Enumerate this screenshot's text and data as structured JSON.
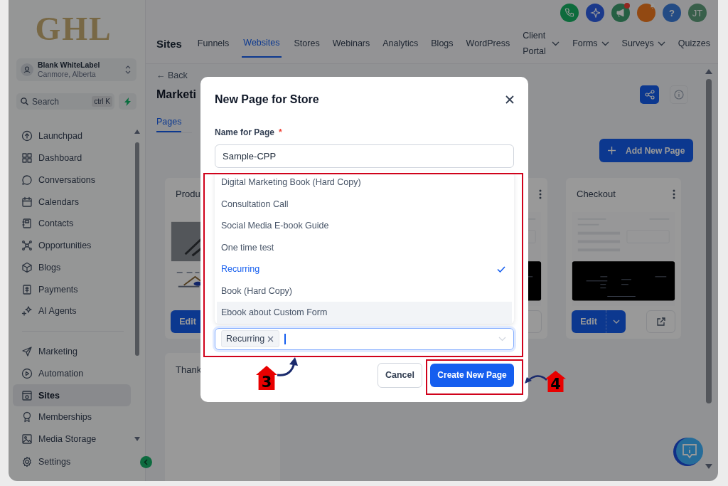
{
  "sidebar": {
    "logo": "GHL",
    "account": {
      "name": "Blank WhiteLabel",
      "location": "Canmore, Alberta"
    },
    "search": {
      "placeholder": "Search",
      "shortcut": "ctrl K"
    },
    "nav_groups": [
      [
        {
          "label": "Launchpad",
          "selected": false
        },
        {
          "label": "Dashboard",
          "selected": false
        },
        {
          "label": "Conversations",
          "selected": false
        },
        {
          "label": "Calendars",
          "selected": false
        },
        {
          "label": "Contacts",
          "selected": false
        },
        {
          "label": "Opportunities",
          "selected": false
        },
        {
          "label": "Blogs",
          "selected": false
        },
        {
          "label": "Payments",
          "selected": false
        },
        {
          "label": "AI Agents",
          "selected": false
        }
      ],
      [
        {
          "label": "Marketing",
          "selected": false
        },
        {
          "label": "Automation",
          "selected": false
        },
        {
          "label": "Sites",
          "selected": true
        },
        {
          "label": "Memberships",
          "selected": false
        },
        {
          "label": "Media Storage",
          "selected": false
        }
      ]
    ],
    "footer_item": {
      "label": "Settings",
      "selected": false
    }
  },
  "header": {
    "help_label": "?",
    "avatar_initials": "JT",
    "section": "Sites",
    "tabs": [
      {
        "label": "Funnels",
        "selected": false,
        "dropdown": false
      },
      {
        "label": "Websites",
        "selected": true,
        "dropdown": false
      },
      {
        "label": "Stores",
        "selected": false,
        "dropdown": false
      },
      {
        "label": "Webinars",
        "selected": false,
        "dropdown": false
      },
      {
        "label": "Analytics",
        "selected": false,
        "dropdown": false
      },
      {
        "label": "Blogs",
        "selected": false,
        "dropdown": false
      },
      {
        "label": "WordPress",
        "selected": false,
        "dropdown": false
      },
      {
        "label": "Client Portal",
        "selected": false,
        "dropdown": true
      },
      {
        "label": "Forms",
        "selected": false,
        "dropdown": true
      },
      {
        "label": "Surveys",
        "selected": false,
        "dropdown": true
      },
      {
        "label": "Quizzes",
        "selected": false,
        "dropdown": false
      }
    ]
  },
  "page": {
    "back": "← Back",
    "title": "Marketi",
    "tabs": [
      {
        "label": "Pages",
        "selected": true
      }
    ],
    "add_button": "Add New Page",
    "cards": [
      {
        "kind": "clipped-left",
        "title": "Produ",
        "edit_label": "Edit"
      },
      {
        "kind": "clipped-right"
      },
      {
        "kind": "full",
        "title": "Checkout",
        "edit_label": "Edit"
      },
      {
        "kind": "title-only",
        "title": "Thank"
      }
    ]
  },
  "modal": {
    "title": "New Page for Store",
    "name_label": "Name for Page",
    "required_mark": "*",
    "name_value": "Sample-CPP",
    "options": [
      {
        "label": "Digital Marketing Book (Hard Copy)",
        "selected": false,
        "highlighted": false
      },
      {
        "label": "Consultation Call",
        "selected": false,
        "highlighted": false
      },
      {
        "label": "Social Media E-book Guide",
        "selected": false,
        "highlighted": false
      },
      {
        "label": "One time test",
        "selected": false,
        "highlighted": false
      },
      {
        "label": "Recurring",
        "selected": true,
        "highlighted": false
      },
      {
        "label": "Book (Hard Copy)",
        "selected": false,
        "highlighted": false
      },
      {
        "label": "Ebook about Custom Form",
        "selected": false,
        "highlighted": true
      }
    ],
    "chosen_tags": [
      "Recurring"
    ],
    "cancel": "Cancel",
    "create": "Create New Page"
  },
  "annotations": [
    {
      "label": "3"
    },
    {
      "label": "4"
    }
  ]
}
